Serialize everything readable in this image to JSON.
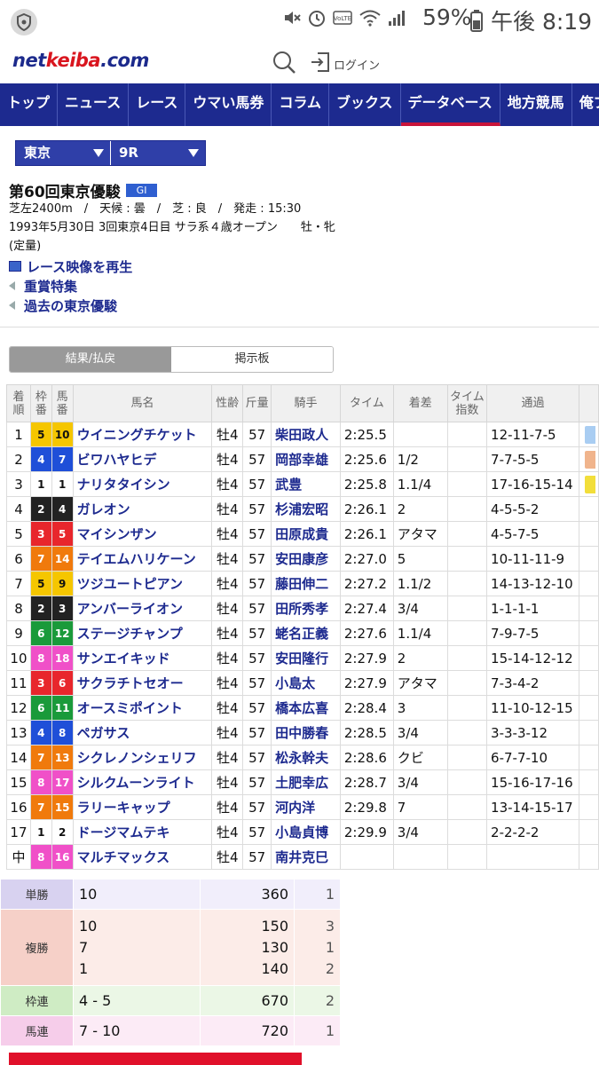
{
  "status_bar": {
    "battery": "59%",
    "time": "午後 8:19",
    "icons": [
      "mute-icon",
      "alarm-icon",
      "volte-icon",
      "wifi-icon",
      "signal-icon",
      "battery-icon"
    ]
  },
  "header": {
    "logo_part1": "net",
    "logo_part2": "keiba",
    "logo_part3": ".com",
    "login_label": "ログイン"
  },
  "nav": {
    "items": [
      "トップ",
      "ニュース",
      "レース",
      "ウマい馬券",
      "コラム",
      "ブックス",
      "データベース",
      "地方競馬",
      "俺プロ"
    ],
    "active": "データベース"
  },
  "selects": {
    "venue": "東京",
    "race": "9R"
  },
  "race": {
    "title": "第60回東京優駿",
    "grade": "GI",
    "line1": "芝左2400m　/　天候 : 曇　/　芝 : 良　/　発走 : 15:30",
    "line2": "1993年5月30日 3回東京4日目 サラ系４歳オープン　　牡・牝",
    "line3": "(定量)"
  },
  "links": {
    "video": "レース映像を再生",
    "special": "重賞特集",
    "past": "過去の東京優駿"
  },
  "tabs": {
    "results": "結果/払戻",
    "board": "掲示板"
  },
  "table": {
    "headers": {
      "rank": "着順",
      "frame": "枠番",
      "horse_no": "馬番",
      "name": "馬名",
      "sex_age": "性齢",
      "weight": "斤量",
      "jockey": "騎手",
      "time": "タイム",
      "margin": "着差",
      "time_index": "タイム指数",
      "passing": "通過"
    },
    "rows": [
      {
        "rank": "1",
        "frame": "5",
        "no": "10",
        "name": "ウイニングチケット",
        "sex_age": "牡4",
        "weight": "57",
        "jockey": "柴田政人",
        "time": "2:25.5",
        "margin": "",
        "index": "",
        "passing": "12-11-7-5",
        "edge": "#a9cdf2"
      },
      {
        "rank": "2",
        "frame": "4",
        "no": "7",
        "name": "ビワハヤヒデ",
        "sex_age": "牡4",
        "weight": "57",
        "jockey": "岡部幸雄",
        "time": "2:25.6",
        "margin": "1/2",
        "index": "",
        "passing": "7-7-5-5",
        "edge": "#f0b48c"
      },
      {
        "rank": "3",
        "frame": "1",
        "no": "1",
        "name": "ナリタタイシン",
        "sex_age": "牡4",
        "weight": "57",
        "jockey": "武豊",
        "time": "2:25.8",
        "margin": "1.1/4",
        "index": "",
        "passing": "17-16-15-14",
        "edge": "#f2de3a"
      },
      {
        "rank": "4",
        "frame": "2",
        "no": "4",
        "name": "ガレオン",
        "sex_age": "牡4",
        "weight": "57",
        "jockey": "杉浦宏昭",
        "time": "2:26.1",
        "margin": "2",
        "index": "",
        "passing": "4-5-5-2",
        "edge": ""
      },
      {
        "rank": "5",
        "frame": "3",
        "no": "5",
        "name": "マイシンザン",
        "sex_age": "牡4",
        "weight": "57",
        "jockey": "田原成貴",
        "time": "2:26.1",
        "margin": "アタマ",
        "index": "",
        "passing": "4-5-7-5",
        "edge": ""
      },
      {
        "rank": "6",
        "frame": "7",
        "no": "14",
        "name": "テイエムハリケーン",
        "sex_age": "牡4",
        "weight": "57",
        "jockey": "安田康彦",
        "time": "2:27.0",
        "margin": "5",
        "index": "",
        "passing": "10-11-11-9",
        "edge": ""
      },
      {
        "rank": "7",
        "frame": "5",
        "no": "9",
        "name": "ツジユートピアン",
        "sex_age": "牡4",
        "weight": "57",
        "jockey": "藤田伸二",
        "time": "2:27.2",
        "margin": "1.1/2",
        "index": "",
        "passing": "14-13-12-10",
        "edge": ""
      },
      {
        "rank": "8",
        "frame": "2",
        "no": "3",
        "name": "アンバーライオン",
        "sex_age": "牡4",
        "weight": "57",
        "jockey": "田所秀孝",
        "time": "2:27.4",
        "margin": "3/4",
        "index": "",
        "passing": "1-1-1-1",
        "edge": ""
      },
      {
        "rank": "9",
        "frame": "6",
        "no": "12",
        "name": "ステージチャンプ",
        "sex_age": "牡4",
        "weight": "57",
        "jockey": "蛯名正義",
        "time": "2:27.6",
        "margin": "1.1/4",
        "index": "",
        "passing": "7-9-7-5",
        "edge": ""
      },
      {
        "rank": "10",
        "frame": "8",
        "no": "18",
        "name": "サンエイキッド",
        "sex_age": "牡4",
        "weight": "57",
        "jockey": "安田隆行",
        "time": "2:27.9",
        "margin": "2",
        "index": "",
        "passing": "15-14-12-12",
        "edge": ""
      },
      {
        "rank": "11",
        "frame": "3",
        "no": "6",
        "name": "サクラチトセオー",
        "sex_age": "牡4",
        "weight": "57",
        "jockey": "小島太",
        "time": "2:27.9",
        "margin": "アタマ",
        "index": "",
        "passing": "7-3-4-2",
        "edge": ""
      },
      {
        "rank": "12",
        "frame": "6",
        "no": "11",
        "name": "オースミポイント",
        "sex_age": "牡4",
        "weight": "57",
        "jockey": "橋本広喜",
        "time": "2:28.4",
        "margin": "3",
        "index": "",
        "passing": "11-10-12-15",
        "edge": ""
      },
      {
        "rank": "13",
        "frame": "4",
        "no": "8",
        "name": "ペガサス",
        "sex_age": "牡4",
        "weight": "57",
        "jockey": "田中勝春",
        "time": "2:28.5",
        "margin": "3/4",
        "index": "",
        "passing": "3-3-3-12",
        "edge": ""
      },
      {
        "rank": "14",
        "frame": "7",
        "no": "13",
        "name": "シクレノンシェリフ",
        "sex_age": "牡4",
        "weight": "57",
        "jockey": "松永幹夫",
        "time": "2:28.6",
        "margin": "クビ",
        "index": "",
        "passing": "6-7-7-10",
        "edge": ""
      },
      {
        "rank": "15",
        "frame": "8",
        "no": "17",
        "name": "シルクムーンライト",
        "sex_age": "牡4",
        "weight": "57",
        "jockey": "土肥幸広",
        "time": "2:28.7",
        "margin": "3/4",
        "index": "",
        "passing": "15-16-17-16",
        "edge": ""
      },
      {
        "rank": "16",
        "frame": "7",
        "no": "15",
        "name": "ラリーキャップ",
        "sex_age": "牡4",
        "weight": "57",
        "jockey": "河内洋",
        "time": "2:29.8",
        "margin": "7",
        "index": "",
        "passing": "13-14-15-17",
        "edge": ""
      },
      {
        "rank": "17",
        "frame": "1",
        "no": "2",
        "name": "ドージマムテキ",
        "sex_age": "牡4",
        "weight": "57",
        "jockey": "小島貞博",
        "time": "2:29.9",
        "margin": "3/4",
        "index": "",
        "passing": "2-2-2-2",
        "edge": ""
      },
      {
        "rank": "中",
        "frame": "8",
        "no": "16",
        "name": "マルチマックス",
        "sex_age": "牡4",
        "weight": "57",
        "jockey": "南井克巳",
        "time": "",
        "margin": "",
        "index": "",
        "passing": "",
        "edge": ""
      }
    ]
  },
  "frame_colors": {
    "1": {
      "bg": "#ffffff",
      "fg": "#111111"
    },
    "2": {
      "bg": "#222222",
      "fg": "#ffffff"
    },
    "3": {
      "bg": "#e8262c",
      "fg": "#ffffff"
    },
    "4": {
      "bg": "#1f4fd8",
      "fg": "#ffffff"
    },
    "5": {
      "bg": "#f5c600",
      "fg": "#111111"
    },
    "6": {
      "bg": "#1a9a3a",
      "fg": "#ffffff"
    },
    "7": {
      "bg": "#f07a0c",
      "fg": "#ffffff"
    },
    "8": {
      "bg": "#f050c8",
      "fg": "#ffffff"
    }
  },
  "payout": {
    "rows": [
      {
        "label": "単勝",
        "combos": [
          "10"
        ],
        "amounts": [
          "360"
        ],
        "pops": [
          "1"
        ],
        "label_bg": "#d8d2f0",
        "row_bg": "#f1eefb"
      },
      {
        "label": "複勝",
        "combos": [
          "10",
          "7",
          "1"
        ],
        "amounts": [
          "150",
          "130",
          "140"
        ],
        "pops": [
          "3",
          "1",
          "2"
        ],
        "label_bg": "#f6d0c8",
        "row_bg": "#fcece8"
      },
      {
        "label": "枠連",
        "combos": [
          "4 - 5"
        ],
        "amounts": [
          "670"
        ],
        "pops": [
          "2"
        ],
        "label_bg": "#cfecc4",
        "row_bg": "#ebf7e6"
      },
      {
        "label": "馬連",
        "combos": [
          "7 - 10"
        ],
        "amounts": [
          "720"
        ],
        "pops": [
          "1"
        ],
        "label_bg": "#f6cdea",
        "row_bg": "#fcebf6"
      }
    ]
  }
}
